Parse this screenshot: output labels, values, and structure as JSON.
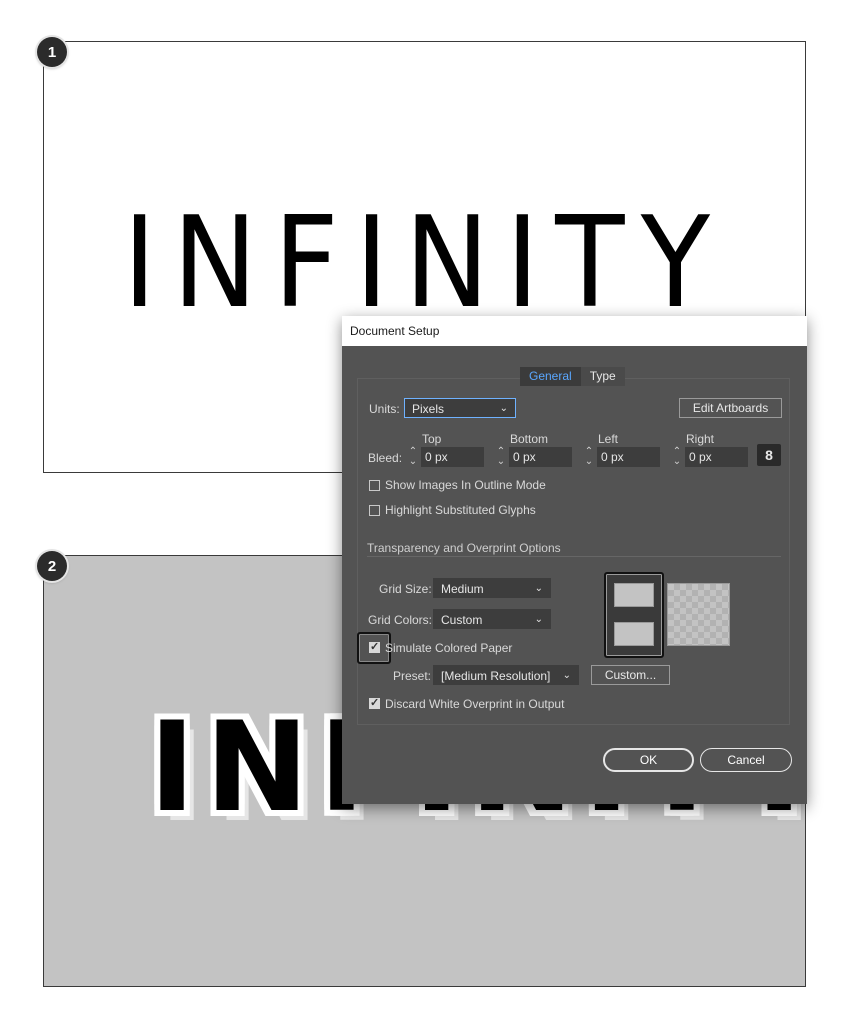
{
  "steps": {
    "one": "1",
    "two": "2"
  },
  "artwork": {
    "word": "INFINITY"
  },
  "dialog": {
    "title": "Document Setup",
    "tabs": [
      {
        "label": "General",
        "active": true
      },
      {
        "label": "Type",
        "active": false
      }
    ],
    "units": {
      "label": "Units:",
      "value": "Pixels"
    },
    "edit_artboards": "Edit Artboards",
    "bleed": {
      "label": "Bleed:",
      "columns": [
        "Top",
        "Bottom",
        "Left",
        "Right"
      ],
      "values": [
        "0 px",
        "0 px",
        "0 px",
        "0 px"
      ]
    },
    "options": {
      "show_images_outline": {
        "label": "Show Images In Outline Mode",
        "checked": false
      },
      "highlight_glyphs": {
        "label": "Highlight Substituted Glyphs",
        "checked": false
      }
    },
    "transparency": {
      "section_title": "Transparency and Overprint Options",
      "grid_size": {
        "label": "Grid Size:",
        "value": "Medium"
      },
      "grid_colors": {
        "label": "Grid Colors:",
        "value": "Custom"
      },
      "simulate_paper": {
        "label": "Simulate Colored Paper",
        "checked": true
      },
      "preset": {
        "label": "Preset:",
        "value": "[Medium Resolution]"
      },
      "custom_button": "Custom...",
      "discard_white": {
        "label": "Discard White Overprint in Output",
        "checked": true
      },
      "grid_color_1": "#c3c3c3",
      "grid_color_2": "#c3c3c3"
    },
    "ok": "OK",
    "cancel": "Cancel"
  },
  "colors": {
    "dialog_bg": "#535353",
    "field_bg": "#3d3d3d",
    "active_tab_text": "#5aa7ff",
    "paper_color": "#c3c3c3"
  }
}
